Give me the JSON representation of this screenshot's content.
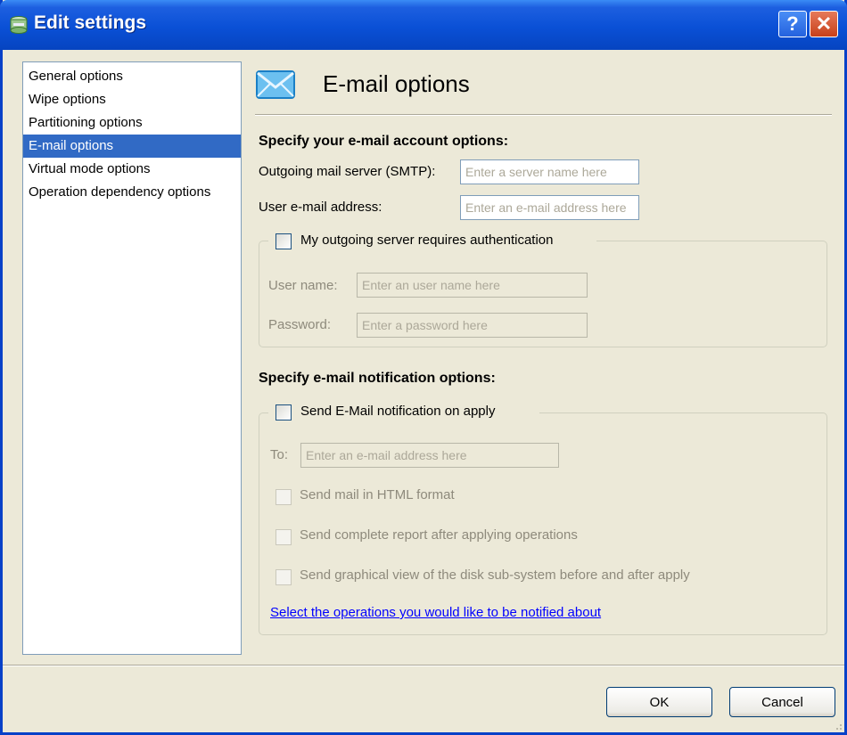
{
  "window": {
    "title": "Edit settings",
    "help_label": "?",
    "close_label": "✕"
  },
  "sidebar": {
    "items": [
      {
        "label": "General options"
      },
      {
        "label": "Wipe options"
      },
      {
        "label": "Partitioning options"
      },
      {
        "label": "E-mail options",
        "selected": true
      },
      {
        "label": "Virtual mode options"
      },
      {
        "label": "Operation dependency options"
      }
    ]
  },
  "page": {
    "title": "E-mail options",
    "icon": "envelope-icon",
    "account_section": {
      "heading": "Specify your e-mail account options:",
      "smtp_label": "Outgoing mail server (SMTP):",
      "smtp_placeholder": "Enter a server name here",
      "smtp_value": "",
      "email_label": "User e-mail address:",
      "email_placeholder": "Enter an e-mail address here",
      "email_value": "",
      "auth_checkbox_label": "My outgoing server requires authentication",
      "auth_checked": false,
      "username_label": "User name:",
      "username_placeholder": "Enter an user name here",
      "password_label": "Password:",
      "password_placeholder": "Enter a password here"
    },
    "notification_section": {
      "heading": "Specify e-mail notification options:",
      "send_checkbox_label": "Send E-Mail notification on apply",
      "send_checked": false,
      "to_label": "To:",
      "to_placeholder": "Enter an e-mail address here",
      "options": [
        {
          "label": "Send mail in HTML format",
          "checked": false
        },
        {
          "label": "Send complete report after applying operations",
          "checked": false
        },
        {
          "label": "Send graphical view of the disk sub-system before and after apply",
          "checked": false
        }
      ],
      "link_text": "Select the operations you would like to be notified about"
    }
  },
  "footer": {
    "ok_label": "OK",
    "cancel_label": "Cancel"
  },
  "colors": {
    "titlebar": "#0a50d6",
    "selection": "#316ac5",
    "dialog_bg": "#ece9d8",
    "link": "#0000ff"
  }
}
